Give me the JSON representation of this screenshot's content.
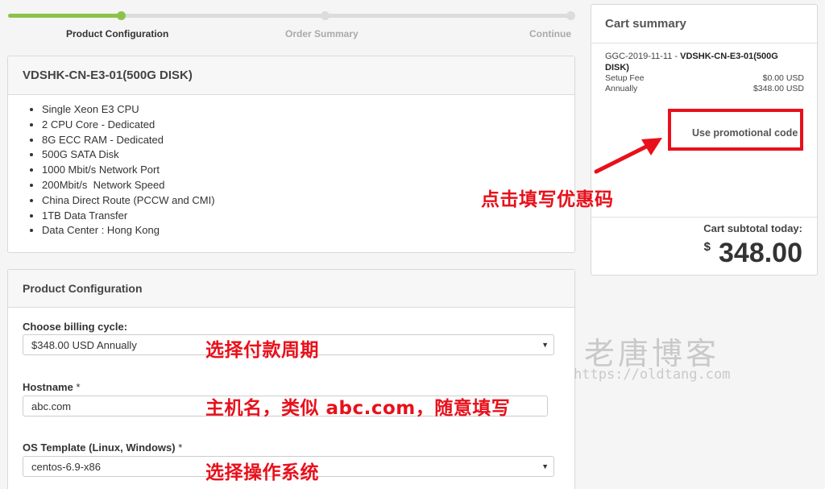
{
  "steps": [
    {
      "label": "Product Configuration",
      "active": true
    },
    {
      "label": "Order Summary",
      "active": false
    },
    {
      "label": "Continue",
      "active": false
    }
  ],
  "product": {
    "title": "VDSHK-CN-E3-01(500G DISK)",
    "features": [
      "Single Xeon E3 CPU",
      "2 CPU Core - Dedicated",
      "8G ECC RAM - Dedicated",
      "500G SATA Disk",
      "1000 Mbit/s Network Port",
      "200Mbit/s  Network Speed",
      "China Direct Route (PCCW and CMI)",
      "1TB Data Transfer",
      "Data Center : Hong Kong"
    ]
  },
  "config": {
    "title": "Product Configuration",
    "billing_label": "Choose billing cycle:",
    "billing_value": "$348.00 USD Annually",
    "hostname_label": "Hostname",
    "hostname_value": "abc.com",
    "os_label": "OS Template (Linux, Windows)",
    "os_value": "centos-6.9-x86",
    "required_mark": "*"
  },
  "cart": {
    "title": "Cart summary",
    "item_prefix": "GGC-2019-11-11 - ",
    "item_name": "VDSHK-CN-E3-01(500G DISK)",
    "lines": [
      {
        "label": "Setup Fee",
        "value": "$0.00 USD"
      },
      {
        "label": "Annually",
        "value": "$348.00 USD"
      }
    ],
    "promo_label": "Use promotional code",
    "subtotal_label": "Cart subtotal today:",
    "currency": "$",
    "subtotal": "348.00"
  },
  "annotations": {
    "promo": "点击填写优惠码",
    "billing": "选择付款周期",
    "hostname": "主机名，类似 abc.com，随意填写",
    "os": "选择操作系统"
  },
  "watermark": {
    "title": "老唐博客",
    "url": "https://oldtang.com"
  },
  "colors": {
    "accent": "#8bc34a",
    "annotation_red": "#e8101b"
  }
}
